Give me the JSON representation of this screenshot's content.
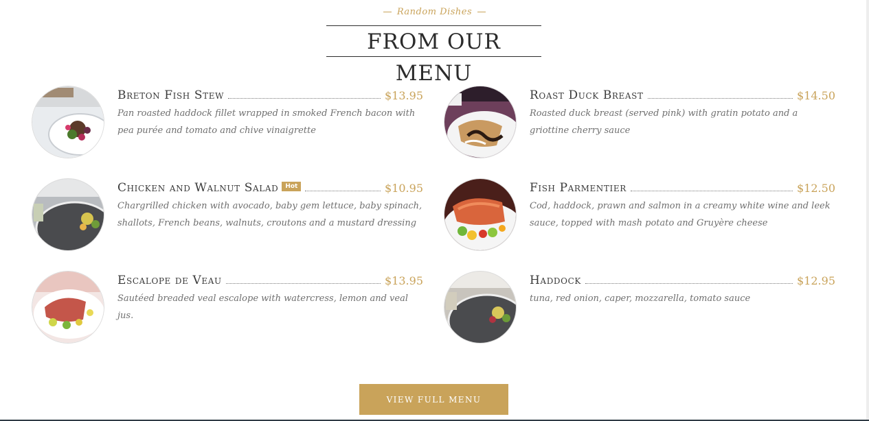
{
  "section": {
    "subtitle": "Random Dishes",
    "title": "FROM OUR MENU"
  },
  "menu": [
    {
      "name": "Breton Fish Stew",
      "price": "$13.95",
      "badge": "",
      "desc": "Pan roasted haddock fillet wrapped in smoked French bacon with pea purée and tomato and chive vinaigrette"
    },
    {
      "name": "Roast Duck Breast",
      "price": "$14.50",
      "badge": "",
      "desc": "Roasted duck breast (served pink) with gratin potato and a griottine cherry sauce"
    },
    {
      "name": "Chicken and Walnut Salad",
      "price": "$10.95",
      "badge": "Hot",
      "desc": "Chargrilled chicken with avocado, baby gem lettuce, baby spinach, shallots, French beans, walnuts, croutons and a mustard dressing"
    },
    {
      "name": "Fish Parmentier",
      "price": "$12.50",
      "badge": "",
      "desc": "Cod, haddock, prawn and salmon in a creamy white wine and leek sauce, topped with mash potato and Gruyère cheese"
    },
    {
      "name": "Escalope de Veau",
      "price": "$13.95",
      "badge": "",
      "desc": "Sautéed breaded veal escalope with watercress, lemon and veal jus."
    },
    {
      "name": "Haddock",
      "price": "$12.95",
      "badge": "",
      "desc": "tuna, red onion, caper, mozzarella, tomato sauce"
    }
  ],
  "cta": {
    "label": "VIEW FULL MENU"
  },
  "colors": {
    "accent": "#c9a35a",
    "text": "#3a3a3a",
    "muted": "#6f6f6f"
  }
}
